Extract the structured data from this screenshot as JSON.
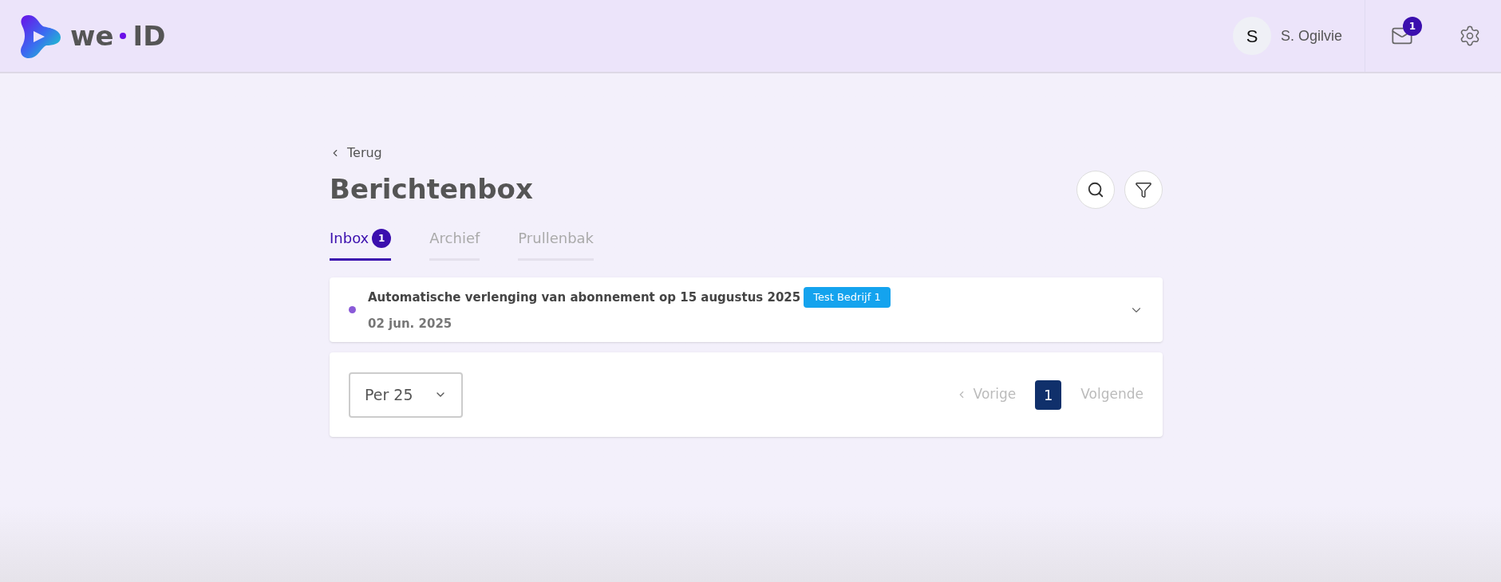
{
  "header": {
    "logo": {
      "left": "we",
      "right": "ID"
    },
    "user": {
      "initial": "S",
      "name": "S. Ogilvie"
    },
    "mail_badge": "1"
  },
  "back_link": "Terug",
  "title": "Berichtenbox",
  "tabs": [
    {
      "label": "Inbox",
      "badge": "1",
      "selected": true
    },
    {
      "label": "Archief",
      "selected": false
    },
    {
      "label": "Prullenbak",
      "selected": false
    }
  ],
  "messages": [
    {
      "subject": "Automatische verlenging van abonnement op 15 augustus 2025",
      "tag": "Test Bedrijf 1",
      "date": "02 jun. 2025",
      "unread": true
    }
  ],
  "pagination": {
    "per_page": "Per 25",
    "previous": "Vorige",
    "next": "Volgende",
    "pages": [
      {
        "label": "1",
        "selected": true
      }
    ]
  }
}
